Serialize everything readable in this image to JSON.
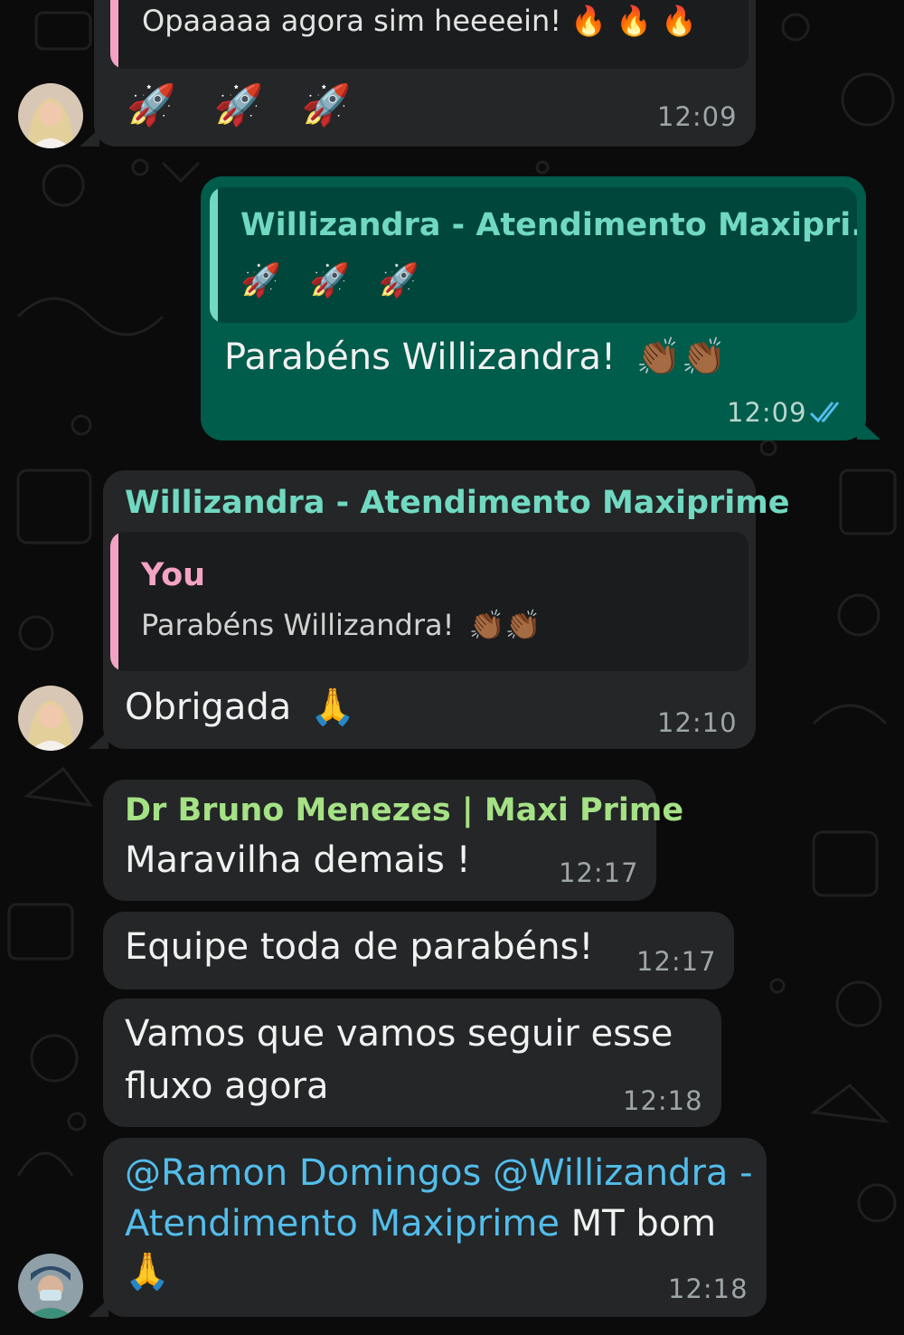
{
  "colors": {
    "background": "#0b0b0b",
    "incoming_bubble": "#242627",
    "outgoing_bubble": "#005c4b",
    "quote_bg_in": "#1b1c1d",
    "quote_bg_out": "#01463a",
    "sender_teal": "#71d9c1",
    "sender_green": "#a5e185",
    "you_pink": "#f4a3c4",
    "mention_blue": "#53bdeb",
    "read_ticks": "#53bdeb"
  },
  "messages": [
    {
      "text": "Opaaaaa agora sim heeeein!",
      "emojis": "🔥 🔥 🔥",
      "second_line_emojis": "🚀 🚀 🚀",
      "time": "12:09",
      "avatar_icon": "woman-avatar-icon"
    },
    {
      "quote_sender": "Willizandra - Atendimento Maxipri...",
      "quote_text": "🚀 🚀 🚀",
      "text": "Parabéns Willizandra!",
      "emojis": "👏🏾👏🏾",
      "time": "12:09",
      "status_icon": "read-double-check-icon"
    },
    {
      "sender": "Willizandra - Atendimento Maxiprime",
      "quote_sender": "You",
      "quote_text": "Parabéns Willizandra!",
      "quote_emojis": "👏🏾👏🏾",
      "text": "Obrigada",
      "emojis": "🙏",
      "time": "12:10",
      "avatar_icon": "woman-avatar-icon"
    },
    {
      "sender": "Dr Bruno Menezes | Maxi Prime",
      "text": "Maravilha demais !",
      "time": "12:17"
    },
    {
      "text": "Equipe toda de parabéns!",
      "time": "12:17"
    },
    {
      "line1": "Vamos que vamos seguir esse",
      "line2": "fluxo agora",
      "time": "12:18"
    },
    {
      "mention1": "@Ramon Domingos",
      "mention2_part1": "@Willizandra -",
      "mention2_part2": "Atendimento Maxiprime",
      "text": "MT bom",
      "emojis": "🙏",
      "time": "12:18",
      "avatar_icon": "doctor-avatar-icon"
    }
  ]
}
